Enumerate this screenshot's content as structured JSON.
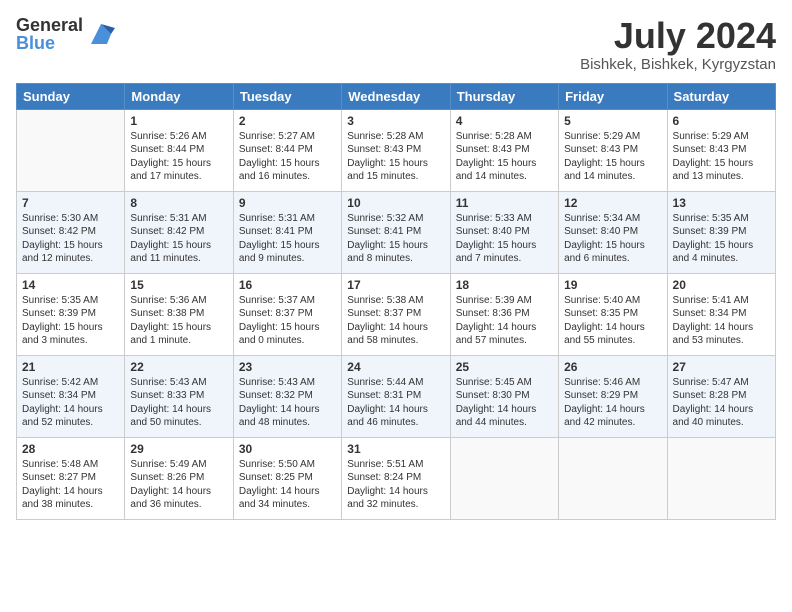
{
  "logo": {
    "general": "General",
    "blue": "Blue"
  },
  "header": {
    "month_title": "July 2024",
    "location": "Bishkek, Bishkek, Kyrgyzstan"
  },
  "days_of_week": [
    "Sunday",
    "Monday",
    "Tuesday",
    "Wednesday",
    "Thursday",
    "Friday",
    "Saturday"
  ],
  "weeks": [
    [
      {
        "day": "",
        "info": ""
      },
      {
        "day": "1",
        "info": "Sunrise: 5:26 AM\nSunset: 8:44 PM\nDaylight: 15 hours\nand 17 minutes."
      },
      {
        "day": "2",
        "info": "Sunrise: 5:27 AM\nSunset: 8:44 PM\nDaylight: 15 hours\nand 16 minutes."
      },
      {
        "day": "3",
        "info": "Sunrise: 5:28 AM\nSunset: 8:43 PM\nDaylight: 15 hours\nand 15 minutes."
      },
      {
        "day": "4",
        "info": "Sunrise: 5:28 AM\nSunset: 8:43 PM\nDaylight: 15 hours\nand 14 minutes."
      },
      {
        "day": "5",
        "info": "Sunrise: 5:29 AM\nSunset: 8:43 PM\nDaylight: 15 hours\nand 14 minutes."
      },
      {
        "day": "6",
        "info": "Sunrise: 5:29 AM\nSunset: 8:43 PM\nDaylight: 15 hours\nand 13 minutes."
      }
    ],
    [
      {
        "day": "7",
        "info": "Sunrise: 5:30 AM\nSunset: 8:42 PM\nDaylight: 15 hours\nand 12 minutes."
      },
      {
        "day": "8",
        "info": "Sunrise: 5:31 AM\nSunset: 8:42 PM\nDaylight: 15 hours\nand 11 minutes."
      },
      {
        "day": "9",
        "info": "Sunrise: 5:31 AM\nSunset: 8:41 PM\nDaylight: 15 hours\nand 9 minutes."
      },
      {
        "day": "10",
        "info": "Sunrise: 5:32 AM\nSunset: 8:41 PM\nDaylight: 15 hours\nand 8 minutes."
      },
      {
        "day": "11",
        "info": "Sunrise: 5:33 AM\nSunset: 8:40 PM\nDaylight: 15 hours\nand 7 minutes."
      },
      {
        "day": "12",
        "info": "Sunrise: 5:34 AM\nSunset: 8:40 PM\nDaylight: 15 hours\nand 6 minutes."
      },
      {
        "day": "13",
        "info": "Sunrise: 5:35 AM\nSunset: 8:39 PM\nDaylight: 15 hours\nand 4 minutes."
      }
    ],
    [
      {
        "day": "14",
        "info": "Sunrise: 5:35 AM\nSunset: 8:39 PM\nDaylight: 15 hours\nand 3 minutes."
      },
      {
        "day": "15",
        "info": "Sunrise: 5:36 AM\nSunset: 8:38 PM\nDaylight: 15 hours\nand 1 minute."
      },
      {
        "day": "16",
        "info": "Sunrise: 5:37 AM\nSunset: 8:37 PM\nDaylight: 15 hours\nand 0 minutes."
      },
      {
        "day": "17",
        "info": "Sunrise: 5:38 AM\nSunset: 8:37 PM\nDaylight: 14 hours\nand 58 minutes."
      },
      {
        "day": "18",
        "info": "Sunrise: 5:39 AM\nSunset: 8:36 PM\nDaylight: 14 hours\nand 57 minutes."
      },
      {
        "day": "19",
        "info": "Sunrise: 5:40 AM\nSunset: 8:35 PM\nDaylight: 14 hours\nand 55 minutes."
      },
      {
        "day": "20",
        "info": "Sunrise: 5:41 AM\nSunset: 8:34 PM\nDaylight: 14 hours\nand 53 minutes."
      }
    ],
    [
      {
        "day": "21",
        "info": "Sunrise: 5:42 AM\nSunset: 8:34 PM\nDaylight: 14 hours\nand 52 minutes."
      },
      {
        "day": "22",
        "info": "Sunrise: 5:43 AM\nSunset: 8:33 PM\nDaylight: 14 hours\nand 50 minutes."
      },
      {
        "day": "23",
        "info": "Sunrise: 5:43 AM\nSunset: 8:32 PM\nDaylight: 14 hours\nand 48 minutes."
      },
      {
        "day": "24",
        "info": "Sunrise: 5:44 AM\nSunset: 8:31 PM\nDaylight: 14 hours\nand 46 minutes."
      },
      {
        "day": "25",
        "info": "Sunrise: 5:45 AM\nSunset: 8:30 PM\nDaylight: 14 hours\nand 44 minutes."
      },
      {
        "day": "26",
        "info": "Sunrise: 5:46 AM\nSunset: 8:29 PM\nDaylight: 14 hours\nand 42 minutes."
      },
      {
        "day": "27",
        "info": "Sunrise: 5:47 AM\nSunset: 8:28 PM\nDaylight: 14 hours\nand 40 minutes."
      }
    ],
    [
      {
        "day": "28",
        "info": "Sunrise: 5:48 AM\nSunset: 8:27 PM\nDaylight: 14 hours\nand 38 minutes."
      },
      {
        "day": "29",
        "info": "Sunrise: 5:49 AM\nSunset: 8:26 PM\nDaylight: 14 hours\nand 36 minutes."
      },
      {
        "day": "30",
        "info": "Sunrise: 5:50 AM\nSunset: 8:25 PM\nDaylight: 14 hours\nand 34 minutes."
      },
      {
        "day": "31",
        "info": "Sunrise: 5:51 AM\nSunset: 8:24 PM\nDaylight: 14 hours\nand 32 minutes."
      },
      {
        "day": "",
        "info": ""
      },
      {
        "day": "",
        "info": ""
      },
      {
        "day": "",
        "info": ""
      }
    ]
  ]
}
